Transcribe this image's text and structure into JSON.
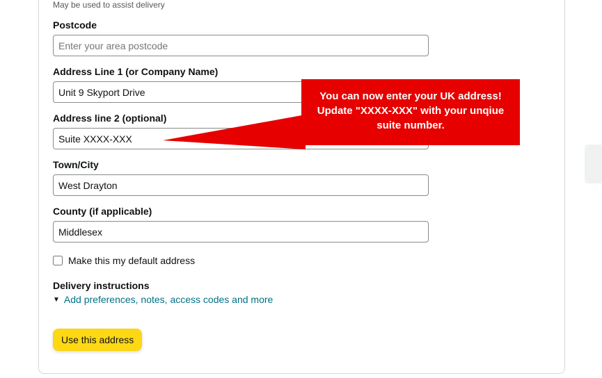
{
  "hint": "May be used to assist delivery",
  "postcode": {
    "label": "Postcode",
    "placeholder": "Enter your area postcode",
    "value": ""
  },
  "address1": {
    "label": "Address Line 1 (or Company Name)",
    "value": "Unit 9 Skyport Drive"
  },
  "address2": {
    "label": "Address line 2 (optional)",
    "value": "Suite XXXX-XXX"
  },
  "city": {
    "label": "Town/City",
    "value": "West Drayton"
  },
  "county": {
    "label": "County (if applicable)",
    "value": "Middlesex"
  },
  "default_checkbox": {
    "label": "Make this my default address"
  },
  "delivery": {
    "heading": "Delivery instructions",
    "link": "Add preferences, notes, access codes and more"
  },
  "submit_label": "Use this address",
  "callout": {
    "line1": "You can now enter your UK address!",
    "line2": "Update \"XXXX-XXX\" with your unqiue",
    "line3": "suite number."
  }
}
